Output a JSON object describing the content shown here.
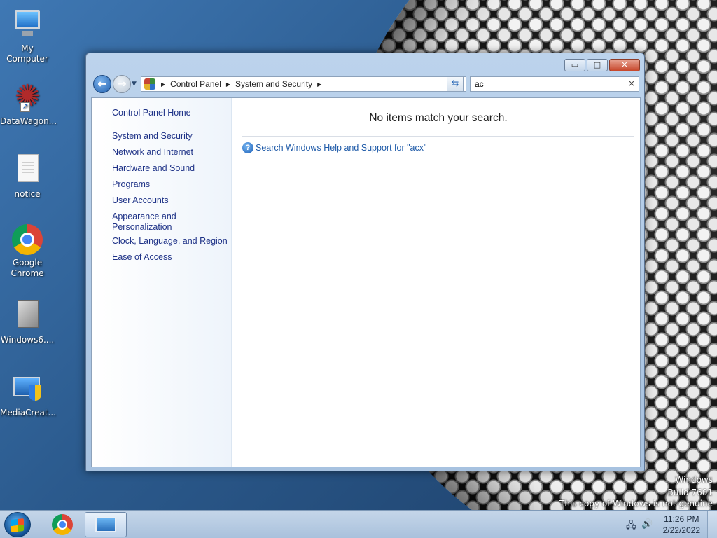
{
  "desktop": {
    "icons": [
      {
        "label": "My Computer"
      },
      {
        "label": "DataWagon..."
      },
      {
        "label": "notice"
      },
      {
        "label": "Google Chrome"
      },
      {
        "label": "Windows6...."
      },
      {
        "label": "MediaCreat..."
      }
    ],
    "watermark": {
      "line1": "Windows",
      "line2": "Build 7601",
      "line3": "This copy of Windows is not genuine"
    }
  },
  "window": {
    "caption": {
      "minimize": "▭",
      "maximize": "□",
      "close": "✕"
    },
    "breadcrumb": [
      "Control Panel",
      "System and Security"
    ],
    "search": {
      "value": "ac",
      "clear": "×"
    },
    "left_pane": {
      "home": "Control Panel Home",
      "items": [
        "System and Security",
        "Network and Internet",
        "Hardware and Sound",
        "Programs",
        "User Accounts",
        "Appearance and Personalization",
        "Clock, Language, and Region",
        "Ease of Access"
      ]
    },
    "main": {
      "no_items": "No items match your search.",
      "help_link": "Search Windows Help and Support for \"acx\""
    }
  },
  "taskbar": {
    "clock": {
      "time": "11:26 PM",
      "date": "2/22/2022"
    }
  },
  "colors": {
    "link": "#1e3287",
    "help_link": "#1e5aa8",
    "window_frame": "#bcd3ec"
  }
}
